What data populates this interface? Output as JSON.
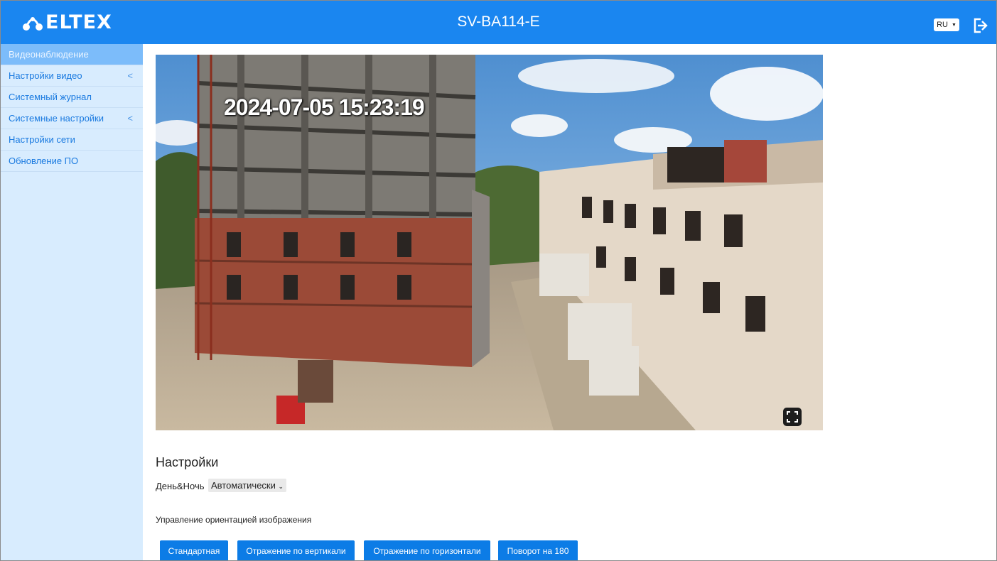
{
  "header": {
    "logo_text": "ELTEX",
    "device_title": "SV-BA114-E",
    "language": "RU"
  },
  "sidebar": {
    "items": [
      {
        "label": "Видеонаблюдение",
        "active": true,
        "expandable": false
      },
      {
        "label": "Настройки видео",
        "active": false,
        "expandable": true
      },
      {
        "label": "Системный журнал",
        "active": false,
        "expandable": false
      },
      {
        "label": "Системные настройки",
        "active": false,
        "expandable": true
      },
      {
        "label": "Настройки сети",
        "active": false,
        "expandable": false
      },
      {
        "label": "Обновление ПО",
        "active": false,
        "expandable": false
      }
    ]
  },
  "video": {
    "timestamp": "2024-07-05 15:23:19"
  },
  "settings": {
    "title": "Настройки",
    "day_night_label": "День&Ночь",
    "day_night_value": "Автоматически",
    "orientation_label": "Управление ориентацией изображения",
    "buttons": {
      "standard": "Стандартная",
      "flip_vertical": "Отражение по вертикали",
      "flip_horizontal": "Отражение по горизонтали",
      "rotate_180": "Поворот на 180"
    }
  },
  "colors": {
    "header_bg": "#1a86f0",
    "sidebar_bg": "#d8ecfe",
    "sidebar_active": "#7cbcfa",
    "button_bg": "#0c7ce6"
  },
  "icons": {
    "logo": "eltex-logo-icon",
    "logout": "logout-icon",
    "fullscreen": "fullscreen-icon",
    "chevron": "chevron-left-icon"
  }
}
